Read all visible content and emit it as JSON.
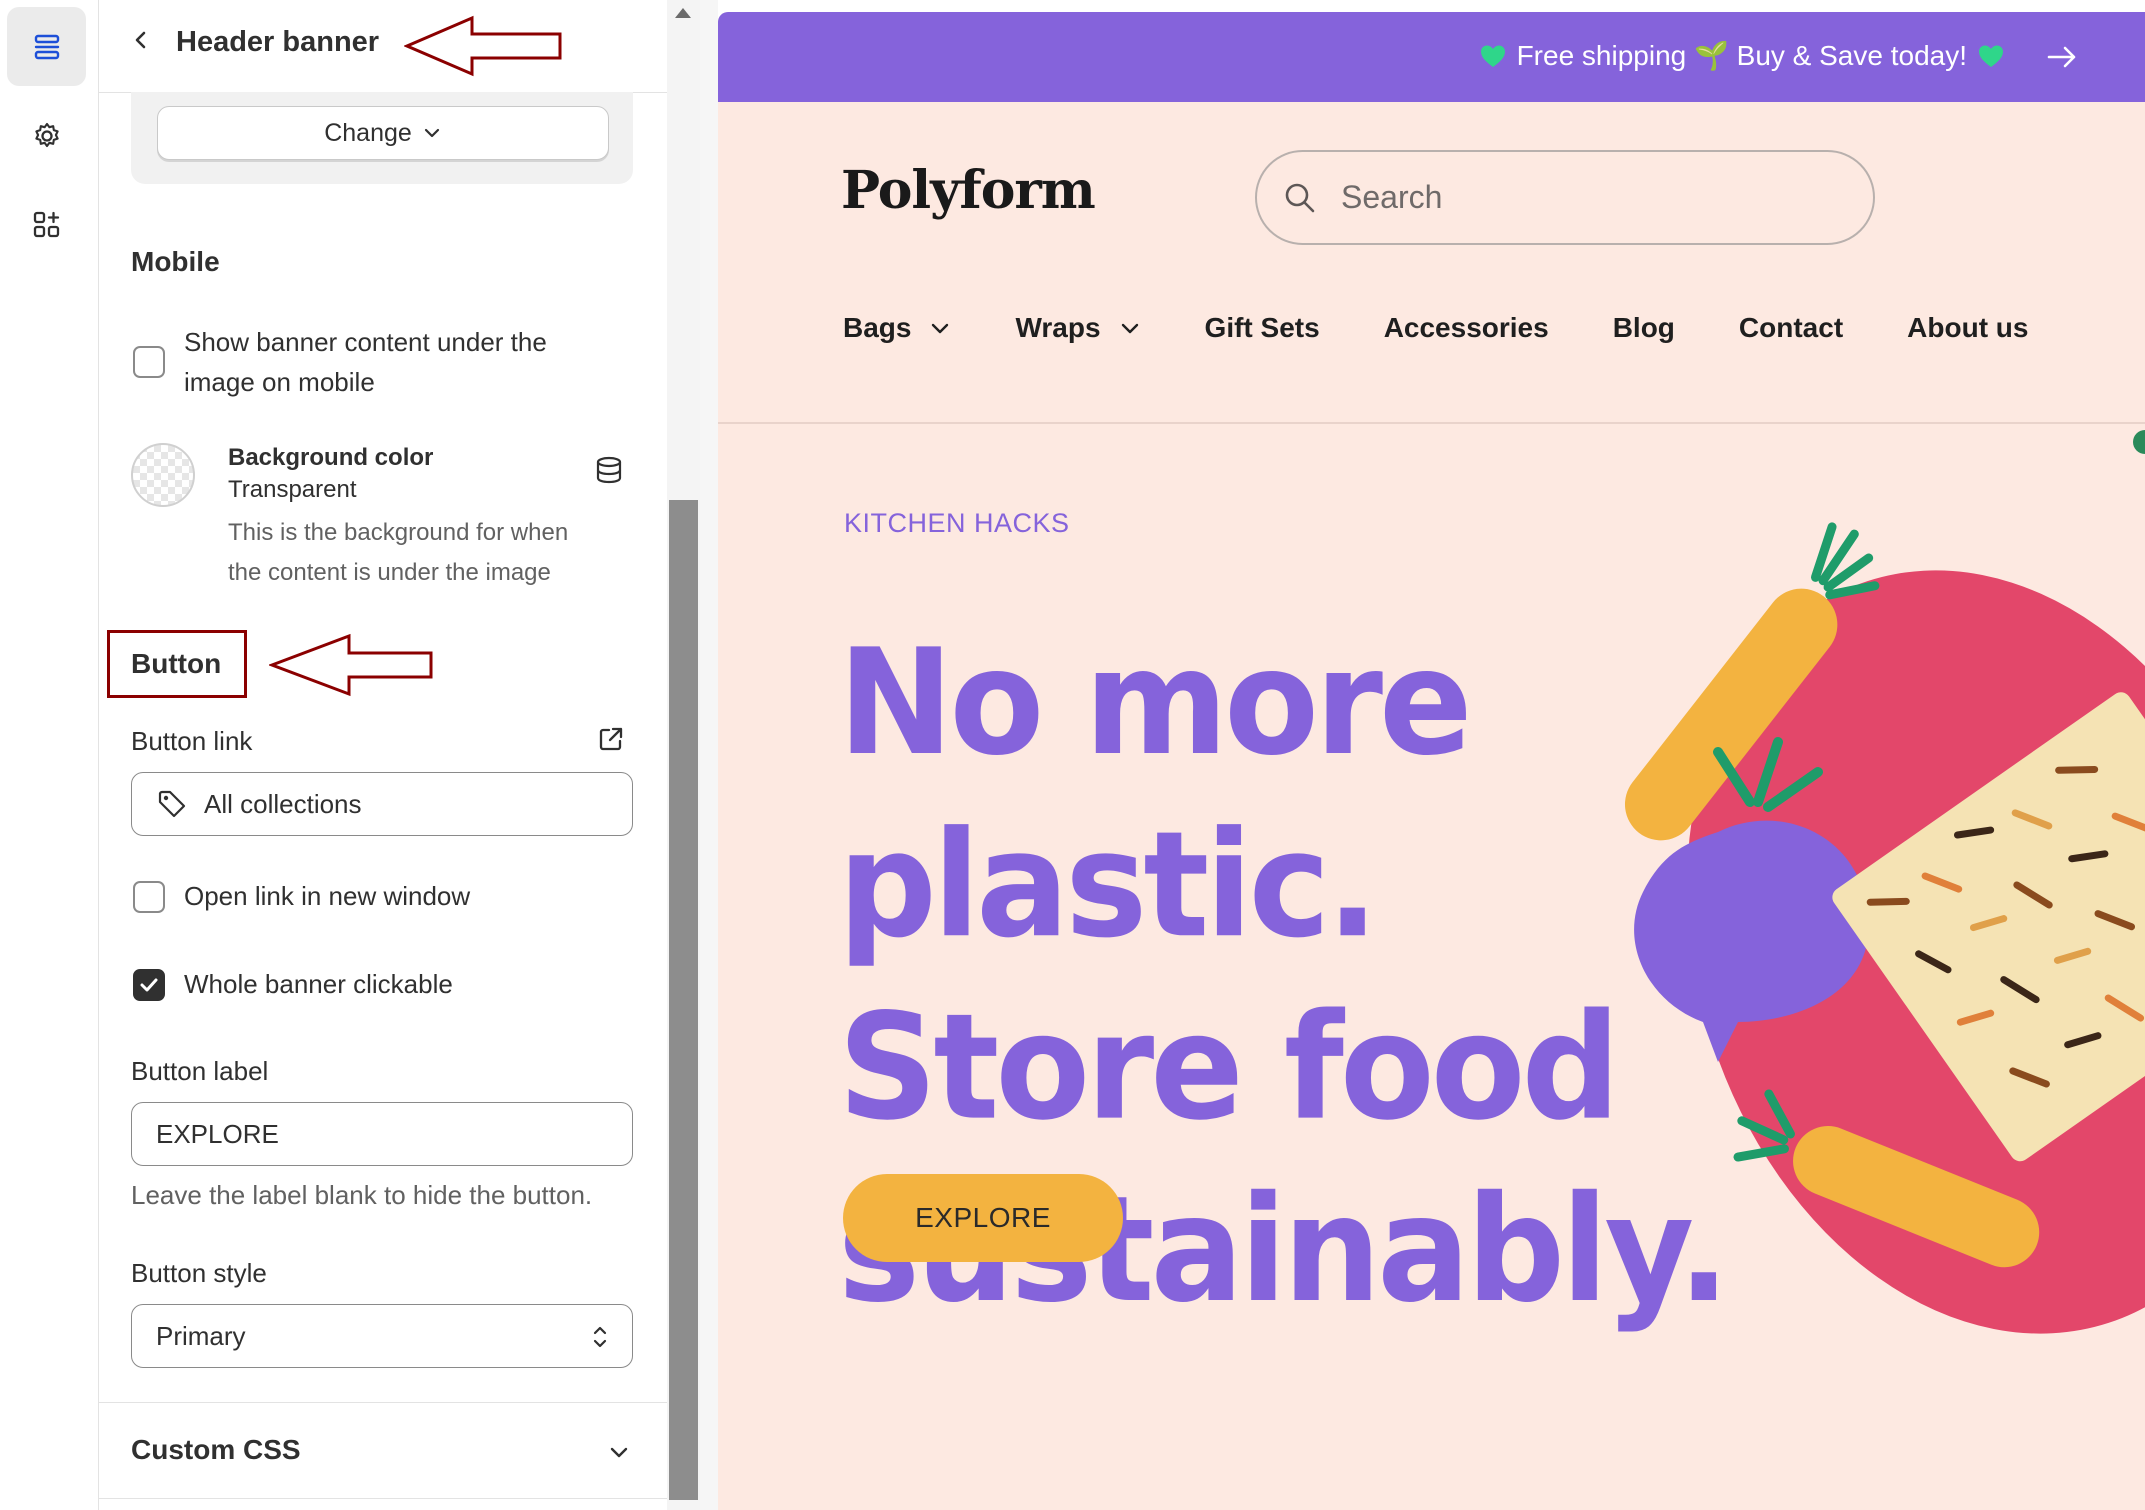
{
  "panel": {
    "title": "Header banner",
    "change_label": "Change",
    "mobile": {
      "title": "Mobile",
      "show_under_image_line1": "Show banner content under the",
      "show_under_image_line2": "image on mobile",
      "background_color_label": "Background color",
      "background_color_value": "Transparent",
      "background_help_line1": "This is the background for when",
      "background_help_line2": "the content is under the image"
    },
    "button": {
      "title": "Button",
      "link_label": "Button link",
      "link_value": "All collections",
      "open_new_window_label": "Open link in new window",
      "open_new_window_checked": false,
      "whole_banner_label": "Whole banner clickable",
      "whole_banner_checked": true,
      "label_label": "Button label",
      "label_value": "EXPLORE",
      "label_help": "Leave the label blank to hide the button.",
      "style_label": "Button style",
      "style_value": "Primary"
    },
    "custom_css_label": "Custom CSS"
  },
  "preview": {
    "announcement": "Free shipping 🌱 Buy & Save today!",
    "logo": "Polyform",
    "search_placeholder": "Search",
    "nav": [
      "Bags",
      "Wraps",
      "Gift Sets",
      "Accessories",
      "Blog",
      "Contact",
      "About us"
    ],
    "kicker": "KITCHEN HACKS",
    "headline_line1": "No more plastic.",
    "headline_line2": "Store food",
    "headline_line3": "sustainably.",
    "cta_label": "EXPLORE"
  },
  "colors": {
    "accent_purple": "#8563db",
    "preview_background": "#fde9e1",
    "cta_yellow": "#f3b340",
    "annotation_red": "#8b0000",
    "heart_green": "#2fd68a"
  },
  "icons": [
    "sections-icon",
    "gear-icon",
    "apps-icon",
    "chevron-left-icon",
    "chevron-down-icon",
    "database-icon",
    "external-link-icon",
    "tag-icon",
    "select-arrows-icon",
    "search-icon",
    "arrow-right-icon",
    "heart-icon"
  ]
}
